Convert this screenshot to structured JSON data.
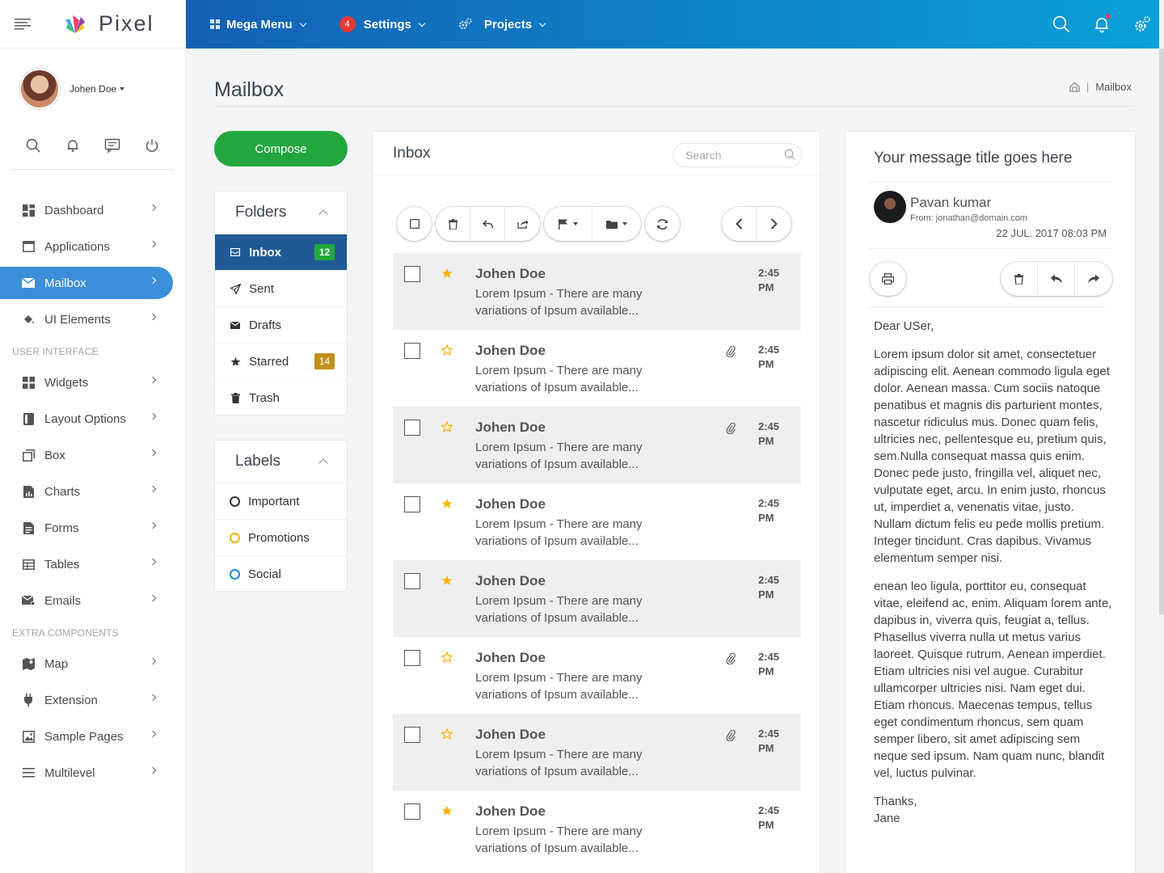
{
  "brand": {
    "name": "Pixel"
  },
  "user": {
    "name": "Johen Doe"
  },
  "sidebar": {
    "items": [
      {
        "label": "Dashboard",
        "icon": "dashboard-icon"
      },
      {
        "label": "Applications",
        "icon": "window-icon"
      },
      {
        "label": "Mailbox",
        "icon": "envelope-icon",
        "active": true
      },
      {
        "label": "UI Elements",
        "icon": "paint-bucket-icon"
      }
    ],
    "section_ui": "USER INTERFACE",
    "ui_items": [
      {
        "label": "Widgets"
      },
      {
        "label": "Layout Options"
      },
      {
        "label": "Box"
      },
      {
        "label": "Charts"
      },
      {
        "label": "Forms"
      },
      {
        "label": "Tables"
      },
      {
        "label": "Emails"
      }
    ],
    "section_extra": "EXTRA COMPONENTS",
    "extra_items": [
      {
        "label": "Map"
      },
      {
        "label": "Extension"
      },
      {
        "label": "Sample Pages"
      },
      {
        "label": "Multilevel"
      }
    ]
  },
  "topbar": {
    "mega_menu": "Mega Menu",
    "settings": "Settings",
    "settings_badge": "4",
    "projects": "Projects"
  },
  "page": {
    "title": "Mailbox",
    "breadcrumb_current": "Mailbox"
  },
  "compose_label": "Compose",
  "folders": {
    "title": "Folders",
    "items": [
      {
        "label": "Inbox",
        "badge": "12",
        "badge_color": "#22a73e",
        "active": true
      },
      {
        "label": "Sent"
      },
      {
        "label": "Drafts"
      },
      {
        "label": "Starred",
        "badge": "14",
        "badge_color": "#c0901a"
      },
      {
        "label": "Trash"
      }
    ]
  },
  "labels": {
    "title": "Labels",
    "items": [
      {
        "label": "Important",
        "color": "#333333"
      },
      {
        "label": "Promotions",
        "color": "#f5b400"
      },
      {
        "label": "Social",
        "color": "#1e88e5"
      }
    ]
  },
  "inbox": {
    "title": "Inbox",
    "search_placeholder": "Search",
    "messages": [
      {
        "sender": "Johen Doe",
        "snippet": "Lorem Ipsum - There are many variations of Ipsum available...",
        "time": "2:45 PM",
        "starred": true,
        "attachment": false
      },
      {
        "sender": "Johen Doe",
        "snippet": "Lorem Ipsum - There are many variations of Ipsum available...",
        "time": "2:45 PM",
        "starred": false,
        "attachment": true
      },
      {
        "sender": "Johen Doe",
        "snippet": "Lorem Ipsum - There are many variations of Ipsum available...",
        "time": "2:45 PM",
        "starred": false,
        "attachment": true
      },
      {
        "sender": "Johen Doe",
        "snippet": "Lorem Ipsum - There are many variations of Ipsum available...",
        "time": "2:45 PM",
        "starred": true,
        "attachment": false
      },
      {
        "sender": "Johen Doe",
        "snippet": "Lorem Ipsum - There are many variations of Ipsum available...",
        "time": "2:45 PM",
        "starred": true,
        "attachment": false
      },
      {
        "sender": "Johen Doe",
        "snippet": "Lorem Ipsum - There are many variations of Ipsum available...",
        "time": "2:45 PM",
        "starred": false,
        "attachment": true
      },
      {
        "sender": "Johen Doe",
        "snippet": "Lorem Ipsum - There are many variations of Ipsum available...",
        "time": "2:45 PM",
        "starred": false,
        "attachment": true
      },
      {
        "sender": "Johen Doe",
        "snippet": "Lorem Ipsum - There are many variations of Ipsum available...",
        "time": "2:45 PM",
        "starred": true,
        "attachment": false
      }
    ]
  },
  "reader": {
    "title": "Your message title goes here",
    "sender_name": "Pavan kumar",
    "sender_from": "From: jonathan@domain.com",
    "date": "22 JUL. 2017 08:03 PM",
    "greeting": "Dear USer,",
    "para1": "Lorem ipsum dolor sit amet, consectetuer adipiscing elit. Aenean commodo ligula eget dolor. Aenean massa. Cum sociis natoque penatibus et magnis dis parturient montes, nascetur ridiculus mus. Donec quam felis, ultricies nec, pellentesque eu, pretium quis, sem.Nulla consequat massa quis enim. Donec pede justo, fringilla vel, aliquet nec, vulputate eget, arcu. In enim justo, rhoncus ut, imperdiet a, venenatis vitae, justo. Nullam dictum felis eu pede mollis pretium. Integer tincidunt. Cras dapibus. Vivamus elementum semper nisi.",
    "para2": "enean leo ligula, porttitor eu, consequat vitae, eleifend ac, enim. Aliquam lorem ante, dapibus in, viverra quis, feugiat a, tellus. Phasellus viverra nulla ut metus varius laoreet. Quisque rutrum. Aenean imperdiet. Etiam ultricies nisi vel augue. Curabitur ullamcorper ultricies nisi. Nam eget dui. Etiam rhoncus. Maecenas tempus, tellus eget condimentum rhoncus, sem quam semper libero, sit amet adipiscing sem neque sed ipsum. Nam quam nunc, blandit vel, luctus pulvinar.",
    "closing": "Thanks,",
    "signature": "Jane"
  },
  "colors": {
    "accent": "#3b8fd9",
    "compose": "#22a73e",
    "inbox_active": "#1f5a94",
    "star": "#f5b400"
  }
}
